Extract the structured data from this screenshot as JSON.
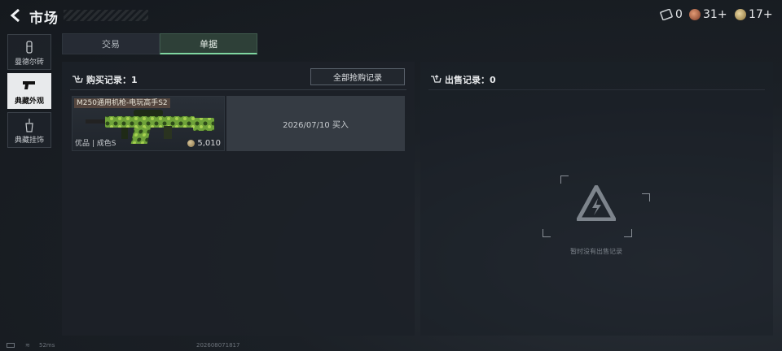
{
  "header": {
    "title": "市场"
  },
  "currencies": [
    {
      "name": "ticket",
      "icon": "ticket-icon",
      "value": "0"
    },
    {
      "name": "bronze",
      "icon": "bronze-medal-icon",
      "value": "31+"
    },
    {
      "name": "gold",
      "icon": "gold-medal-icon",
      "value": "17+"
    }
  ],
  "sidebar": {
    "items": [
      {
        "label": "曼德尔砖",
        "icon": "brick-icon",
        "active": false
      },
      {
        "label": "典藏外观",
        "icon": "pistol-icon",
        "active": true
      },
      {
        "label": "典藏挂饰",
        "icon": "charm-icon",
        "active": false
      }
    ]
  },
  "tabs": [
    {
      "label": "交易",
      "active": false
    },
    {
      "label": "单据",
      "active": true
    }
  ],
  "purchase": {
    "heading": "购买记录：1",
    "all_button": "全部抢购记录",
    "records": [
      {
        "item_name": "M250通用机枪-电玩高手S2",
        "quality": "优品 | 成色S",
        "price": "5,010",
        "info": "2026/07/10 买入"
      }
    ]
  },
  "sale": {
    "heading": "出售记录：0",
    "empty_text": "暂时没有出售记录"
  },
  "footer": {
    "ping": "52ms",
    "build": "202608071817"
  },
  "colors": {
    "accent": "#7fd6a0",
    "panel": "#1c2128",
    "active_sidebar": "#e8eaec"
  }
}
